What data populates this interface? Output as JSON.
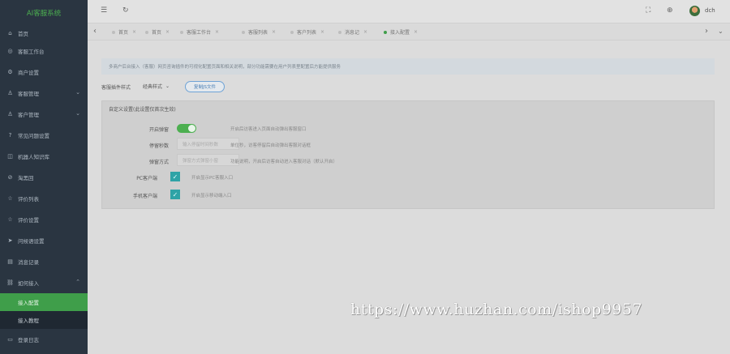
{
  "app": {
    "title": "AI客服系统"
  },
  "sidebar": {
    "items": [
      {
        "label": "首页",
        "icon": "home-icon",
        "glyph": "⌂",
        "chevron": ""
      },
      {
        "label": "客服工作台",
        "icon": "monitor-icon",
        "glyph": "◎",
        "chevron": ""
      },
      {
        "label": "商户设置",
        "icon": "store-icon",
        "glyph": "⚙",
        "chevron": ""
      },
      {
        "label": "客服管理",
        "icon": "user-icon",
        "glyph": "♙",
        "chevron": "⌄"
      },
      {
        "label": "客户管理",
        "icon": "customers-icon",
        "glyph": "♙",
        "chevron": "⌄"
      },
      {
        "label": "常见问题设置",
        "icon": "question-icon",
        "glyph": "?",
        "chevron": ""
      },
      {
        "label": "机器人知识库",
        "icon": "robot-icon",
        "glyph": "◫",
        "chevron": ""
      },
      {
        "label": "淘黑回",
        "icon": "blacklist-icon",
        "glyph": "⊘",
        "chevron": ""
      },
      {
        "label": "评价列表",
        "icon": "comment-icon",
        "glyph": "☆",
        "chevron": ""
      },
      {
        "label": "评价设置",
        "icon": "rating-icon",
        "glyph": "☆",
        "chevron": ""
      },
      {
        "label": "问候语设置",
        "icon": "send-icon",
        "glyph": "➤",
        "chevron": ""
      },
      {
        "label": "消息记录",
        "icon": "message-icon",
        "glyph": "▤",
        "chevron": ""
      },
      {
        "label": "如何接入",
        "icon": "link-icon",
        "glyph": "⛓",
        "chevron": "⌃"
      }
    ],
    "sub_items": [
      {
        "label": "接入配置",
        "active": true
      },
      {
        "label": "接入教程",
        "active": false
      }
    ],
    "last_item": {
      "label": "登录日志",
      "icon": "log-icon",
      "glyph": "▭"
    }
  },
  "header": {
    "menu_icon": "☰",
    "refresh_icon": "↻",
    "fullscreen_icon": "⛶",
    "settings_icon": "⊕",
    "user_name": "dch"
  },
  "tabs": {
    "left_arrow": "‹",
    "right_arrow": "›",
    "down_arrow": "⌄",
    "items": [
      {
        "label": "首页",
        "active": false
      },
      {
        "label": "首页",
        "active": false
      },
      {
        "label": "客服工作台",
        "active": false
      },
      {
        "label": "客服列表",
        "active": false
      },
      {
        "label": "客户列表",
        "active": false
      },
      {
        "label": "消息记",
        "active": false
      },
      {
        "label": "接入配置",
        "active": true
      }
    ]
  },
  "main": {
    "notice": "多商户后台接入（客服）网页咨询插件的可视化配置页面和相关说明，部分功能需要在用户列表里配置后方能提供服务",
    "theme_label": "客服插件样式",
    "theme_value": "经典样式",
    "preview_button": "复制JS文件",
    "panel_title": "自定义设置(此设置仅首次生效)",
    "fields": {
      "switch_label": "开启弹窗",
      "switch_help": "开启后访客进入页面自动弹出客服窗口",
      "delay_label": "停留秒数",
      "delay_placeholder": "输入停留时间秒数",
      "delay_help": "单位秒，访客停留后自动弹出客服对话框",
      "popup_label": "弹窗方式",
      "popup_placeholder": "弹窗方式弹窗小窗",
      "popup_help": "功能说明，开启后访客自动进入客服对话（默认开启）",
      "pc_label": "PC客户端",
      "pc_help": "开启显示PC客服入口",
      "mobile_label": "手机客户端",
      "mobile_help": "开启显示移动端入口"
    }
  },
  "watermark": "https://www.huzhan.com/ishop9957",
  "colors": {
    "sidebar_bg": "#2a3541",
    "accent": "#4caf50",
    "checkbox": "#2fa3a6"
  }
}
